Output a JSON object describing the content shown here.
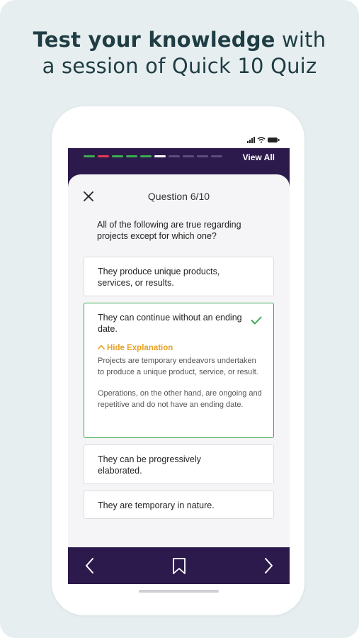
{
  "headline": {
    "strong": "Test your knowledge",
    "rest_line1": " with",
    "line2": "a session of Quick 10 Quiz"
  },
  "progress": {
    "total": 10,
    "segments": [
      "correct",
      "wrong",
      "correct",
      "correct",
      "correct",
      "current",
      "pending",
      "pending",
      "pending",
      "pending"
    ],
    "colors": {
      "correct": "#3cab4e",
      "wrong": "#e03c4f",
      "current": "#ffffff",
      "pending": "#5e4c7e"
    }
  },
  "header": {
    "view_all": "View All",
    "question_count": "Question 6/10"
  },
  "question": "All of the following are true regarding projects except for which one?",
  "options": [
    {
      "text": "They produce unique products, services, or results."
    },
    {
      "text": "They can continue without an ending date.",
      "correct": true,
      "toggle_label": "Hide Explanation",
      "explanation_1": "Projects are temporary endeavors undertaken to produce a unique product, service, or result.",
      "explanation_2": "Operations, on the other hand, are ongoing and repetitive and do not have an ending date."
    },
    {
      "text": "They can be progressively elaborated."
    },
    {
      "text": "They are temporary in nature."
    }
  ],
  "colors": {
    "brand_purple": "#2c1a4d",
    "correct_green": "#3cab4e",
    "explanation_orange": "#e8a020",
    "background": "#e6eef0"
  },
  "icons": {
    "close": "close-icon",
    "check": "check-icon",
    "prev": "chevron-left-icon",
    "bookmark": "bookmark-icon",
    "next": "chevron-right-icon"
  }
}
